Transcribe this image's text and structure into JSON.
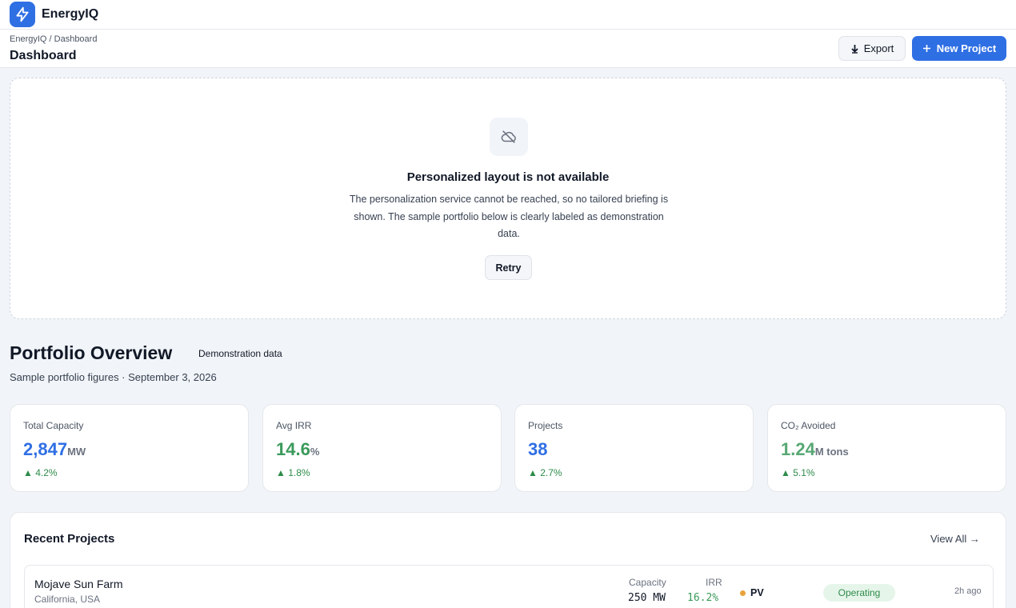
{
  "app": {
    "name": "EnergyIQ",
    "logo_icon": "bolt-icon",
    "accent": "#2f6fe4"
  },
  "header": {
    "breadcrumb": "EnergyIQ / Dashboard",
    "title": "Dashboard",
    "export_label": "Export",
    "new_project_label": "New Project"
  },
  "notice": {
    "icon": "cloud-off-icon",
    "title": "Personalized layout is not available",
    "body": "The personalization service cannot be reached, so no tailored briefing is shown. The sample portfolio below is clearly labeled as demonstration data.",
    "retry_label": "Retry"
  },
  "overview": {
    "title": "Portfolio Overview",
    "badge": "Demonstration data",
    "subtitle": "Sample portfolio figures · September 3, 2026"
  },
  "metrics": [
    {
      "label": "Total Capacity",
      "value": "2,847",
      "unit": "MW",
      "delta": "▲ 4.2%",
      "color": "#2f6fe4"
    },
    {
      "label": "Avg IRR",
      "value": "14.6",
      "unit": "%",
      "delta": "▲ 1.8%",
      "color": "#3a9a5b"
    },
    {
      "label": "Projects",
      "value": "38",
      "unit": "",
      "delta": "▲ 2.7%",
      "color": "#2f6fe4"
    },
    {
      "label": "CO₂ Avoided",
      "value": "1.24",
      "unit": "M tons",
      "delta": "▲ 5.1%",
      "color": "#57a873"
    }
  ],
  "recent": {
    "title": "Recent Projects",
    "view_all_label": "View All →",
    "projects": [
      {
        "name": "Mojave Sun Farm",
        "location": "California, USA",
        "capacity_label": "Capacity",
        "capacity": "250 MW",
        "irr_label": "IRR",
        "irr": "16.2%",
        "tech": "PV",
        "status": "Operating",
        "updated": "2h ago"
      }
    ]
  }
}
